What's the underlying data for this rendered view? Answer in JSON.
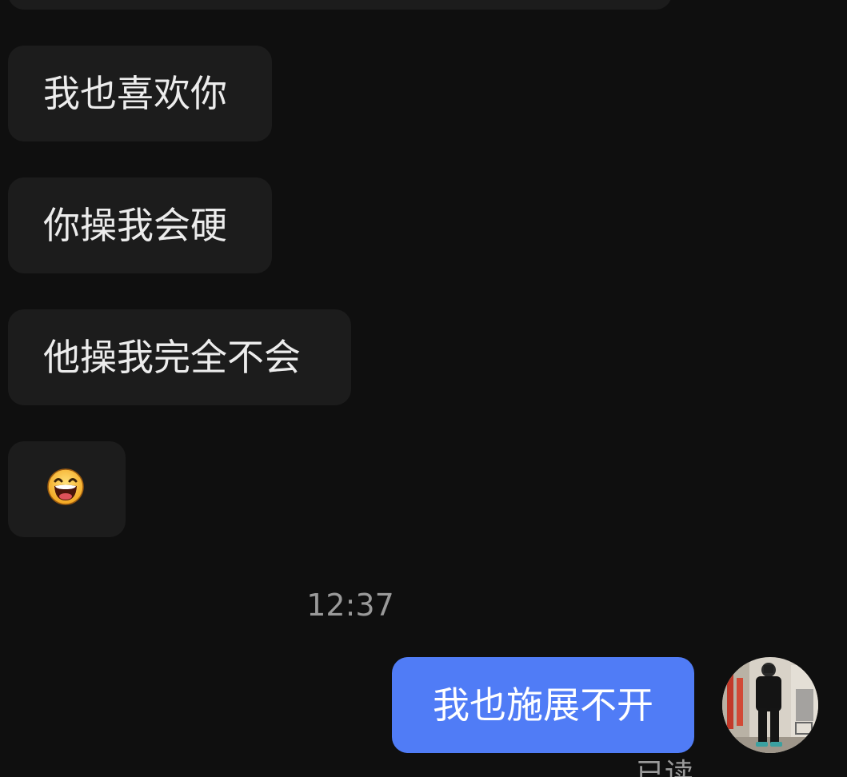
{
  "messages": {
    "incoming": [
      {
        "text": "我也喜欢你"
      },
      {
        "text": "你操我会硬"
      },
      {
        "text": "他操我完全不会"
      }
    ],
    "emoji": "laughing-face-emoji",
    "timestamp": "12:37",
    "outgoing": {
      "text": "我也施展不开"
    },
    "read_status": "已读"
  },
  "colors": {
    "background": "#0f0f0f",
    "incoming_bubble": "#1c1c1c",
    "outgoing_bubble": "#507cf6",
    "timestamp_text": "#9a9a9a"
  }
}
